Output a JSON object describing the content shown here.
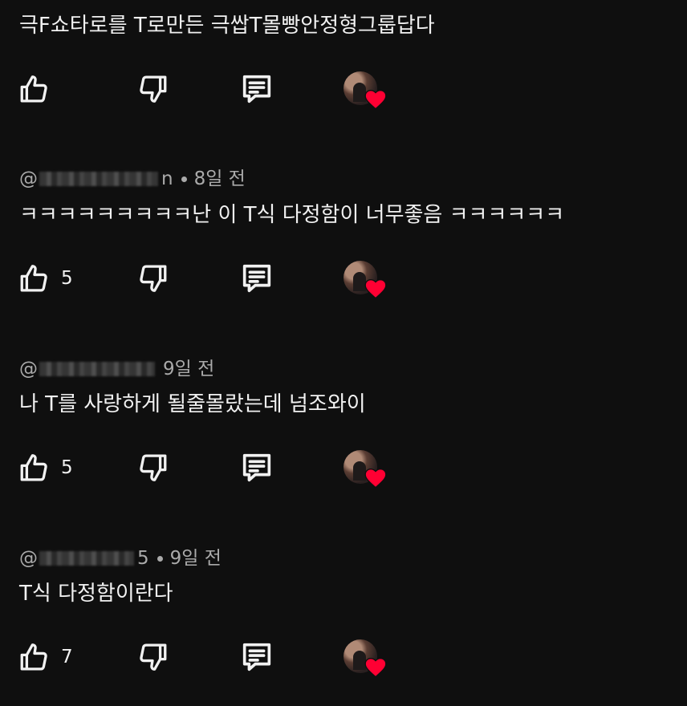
{
  "comments": [
    {
      "handle_visible_start": "",
      "handle_visible_end": "",
      "time": "",
      "text": "극F쇼타로를 T로만든 극쌉T몰빵안정형그룹답다",
      "like_count": ""
    },
    {
      "handle_visible_start": "@",
      "handle_visible_end": "n",
      "time": "8일 전",
      "text": "ㅋㅋㅋㅋㅋㅋㅋㅋㅋ난 이 T식 다정함이 너무좋음 ㅋㅋㅋㅋㅋㅋ",
      "like_count": "5"
    },
    {
      "handle_visible_start": "@",
      "handle_visible_end": "",
      "time": "9일 전",
      "text": "나 T를 사랑하게 될줄몰랐는데 넘조와이",
      "like_count": "5"
    },
    {
      "handle_visible_start": "@",
      "handle_visible_end": "5",
      "time": "9일 전",
      "text": "T식 다정함이란다",
      "like_count": "7"
    }
  ],
  "icons": {
    "like": "thumbs-up-icon",
    "dislike": "thumbs-down-icon",
    "reply": "comment-icon",
    "creator_heart": "heart-icon"
  },
  "colors": {
    "background": "#0f0f0f",
    "text": "#f1f1f1",
    "meta": "#aaaaaa",
    "heart": "#ff0033"
  }
}
